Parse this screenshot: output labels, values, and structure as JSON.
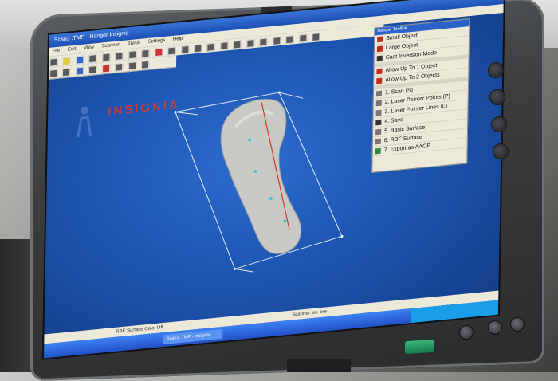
{
  "app": {
    "title": "Scan3 .TMP - Hanger Insignia",
    "menu": [
      "File",
      "Edit",
      "View",
      "Scanner",
      "Stylus",
      "Settings",
      "Help"
    ],
    "logo_text": "INSIGNIA",
    "status_text": "Scanner: on-line",
    "task_button": "Scan3 .TMP - Insignia",
    "mode_text": "RBF Surface Calc: Off"
  },
  "toolbox": {
    "title": "Hanger Toolbar",
    "items": [
      {
        "label": "Small Object",
        "icon": "red-square-icon"
      },
      {
        "label": "Large Object",
        "icon": "red-square-icon"
      },
      {
        "label": "Cast Inversion Mode",
        "icon": "cast-icon"
      },
      {
        "label": "Allow Up To 1 Object",
        "icon": "red-square-icon"
      },
      {
        "label": "Allow Up To 2 Objects",
        "icon": "red-square-icon"
      },
      {
        "label": "1. Scan (S)",
        "icon": "scan-icon"
      },
      {
        "label": "2. Laser Pointer Points (P)",
        "icon": "points-icon"
      },
      {
        "label": "3. Laser Pointer Lines (L)",
        "icon": "lines-icon"
      },
      {
        "label": "4. Save",
        "icon": "save-icon"
      },
      {
        "label": "5. Basic Surface",
        "icon": "surface-icon"
      },
      {
        "label": "6. RBF Surface",
        "icon": "rbf-icon"
      },
      {
        "label": "7. Export as AAOP",
        "icon": "export-icon"
      }
    ]
  },
  "colors": {
    "viewport_blue": "#1e55b2",
    "logo_red": "#d43b2e",
    "model_gray": "#c8c9c4",
    "bbox_line": "#dfe8f5"
  }
}
